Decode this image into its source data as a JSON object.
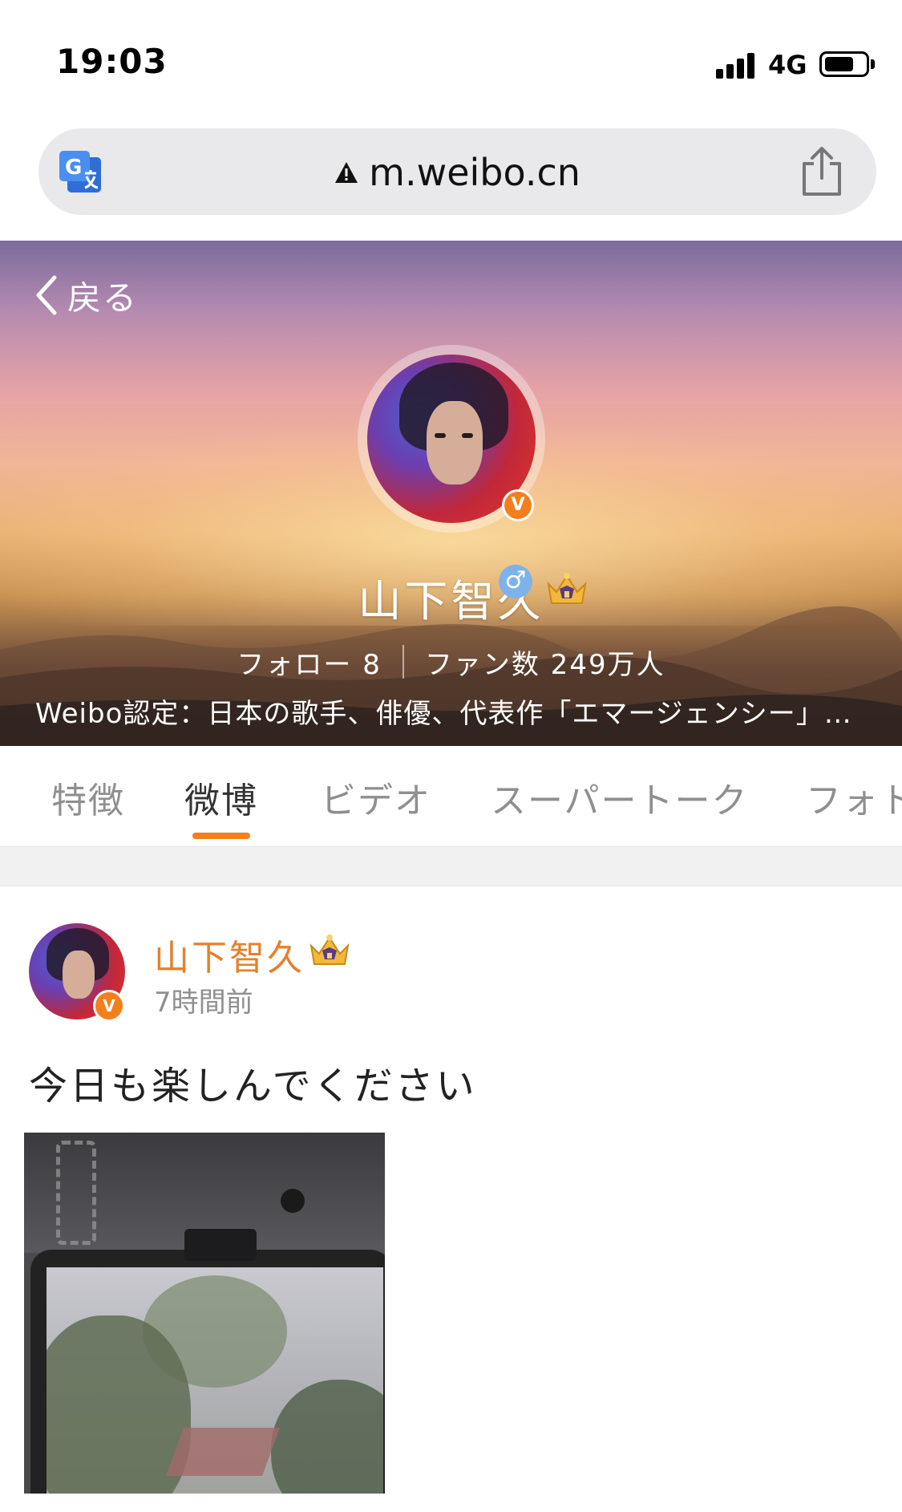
{
  "status_bar": {
    "time": "19:03",
    "network": "4G",
    "battery_level": 0.7
  },
  "browser": {
    "url": "m.weibo.cn",
    "translate_icon": "translate-icon",
    "warning_icon": "warning-triangle-icon",
    "share_icon": "share-icon"
  },
  "profile": {
    "back_label": "戻る",
    "name": "山下智久",
    "gender_symbol": "♂",
    "verify_mark": "V",
    "stats": {
      "follow": "フォロー 8",
      "fans": "ファン数 249万人"
    },
    "verification": "Weibo認定：日本の歌手、俳優、代表作「エマージェンシー」…"
  },
  "tabs": [
    {
      "label": "特徴",
      "active": false
    },
    {
      "label": "微博",
      "active": true
    },
    {
      "label": "ビデオ",
      "active": false
    },
    {
      "label": "スーパートーク",
      "active": false
    },
    {
      "label": "フォト",
      "active": false
    }
  ],
  "post": {
    "author": "山下智久",
    "time": "7時間前",
    "text": "今日も楽しんでください",
    "verify_mark": "V"
  },
  "colors": {
    "accent": "#f37f1c",
    "author_name": "#e5802c",
    "tab_inactive": "#8f8f8f",
    "gender_badge": "#7db3ea"
  }
}
